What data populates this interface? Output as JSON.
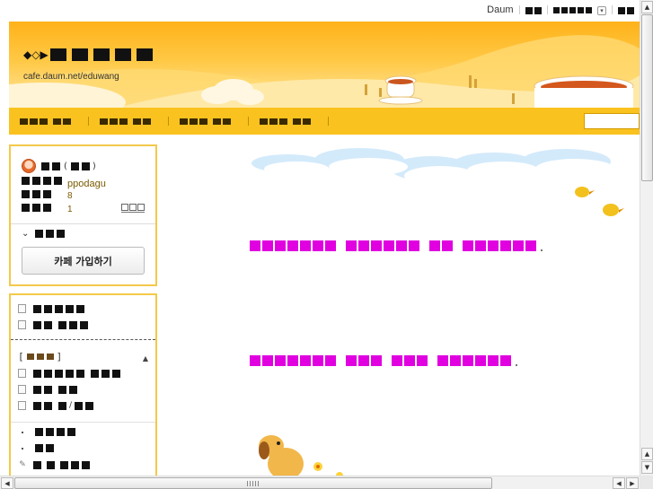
{
  "top_links": {
    "daum": "Daum"
  },
  "header": {
    "cafe_url": "cafe.daum.net/eduwang",
    "title_arrows": "◆◇▶"
  },
  "profile": {
    "nickname": "ppodagu",
    "visit_count": "8",
    "post_count": "1",
    "join_button": "카페 가입하기"
  },
  "colors": {
    "accent": "#f9c21e",
    "border": "#f3c94a",
    "notice": "#e000e0"
  },
  "icons": {
    "avatar": "avatar-icon",
    "dropdown": "chevron-down-icon",
    "toggle": "triangle-up-icon",
    "pen": "pencil-icon"
  }
}
